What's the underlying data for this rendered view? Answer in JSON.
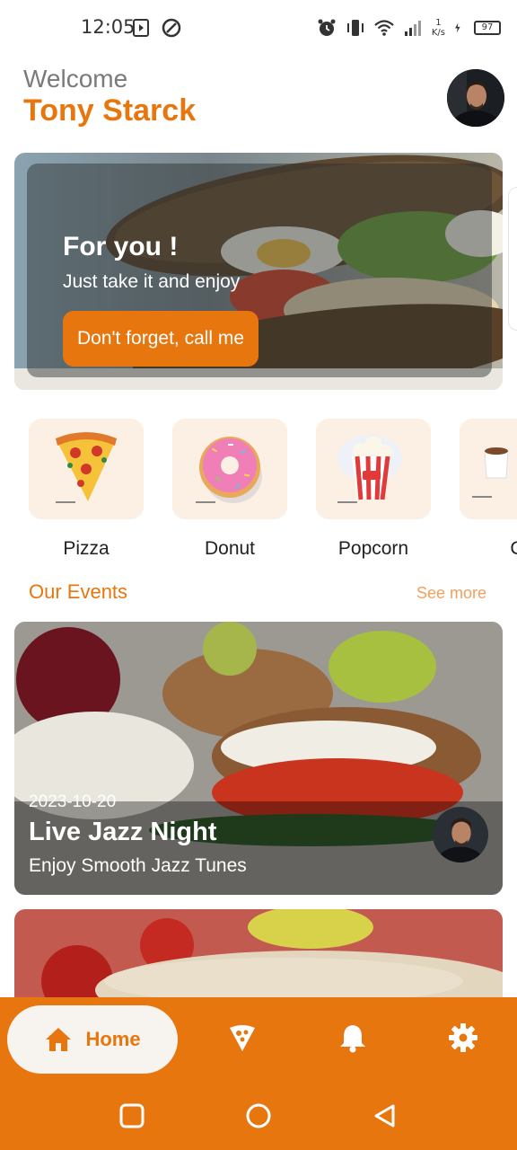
{
  "status_bar": {
    "time": "12:05",
    "speed_top": "1",
    "speed_unit": "K/s",
    "battery": "97"
  },
  "header": {
    "welcome": "Welcome",
    "user_name": "Tony Starck"
  },
  "hero": {
    "title": "For you !",
    "subtitle": "Just take it and enjoy",
    "button_label": "Don't forget, call me"
  },
  "categories": [
    {
      "label": "Pizza",
      "icon": "pizza-icon"
    },
    {
      "label": "Donut",
      "icon": "donut-icon"
    },
    {
      "label": "Popcorn",
      "icon": "popcorn-icon"
    },
    {
      "label": "C",
      "icon": "coffee-icon"
    }
  ],
  "events_section": {
    "title": "Our Events",
    "see_more": "See more"
  },
  "events": [
    {
      "date": "2023-10-20",
      "title": "Live Jazz Night",
      "subtitle": "Enjoy Smooth Jazz Tunes"
    }
  ],
  "bottom_nav": {
    "home_label": "Home",
    "items": [
      "home-icon",
      "pizza-slice-icon",
      "bell-icon",
      "gear-icon"
    ]
  },
  "colors": {
    "accent": "#e8760f",
    "tile_bg": "#fcefe3",
    "section_title": "#e8760f",
    "see_more": "#f0a060"
  }
}
